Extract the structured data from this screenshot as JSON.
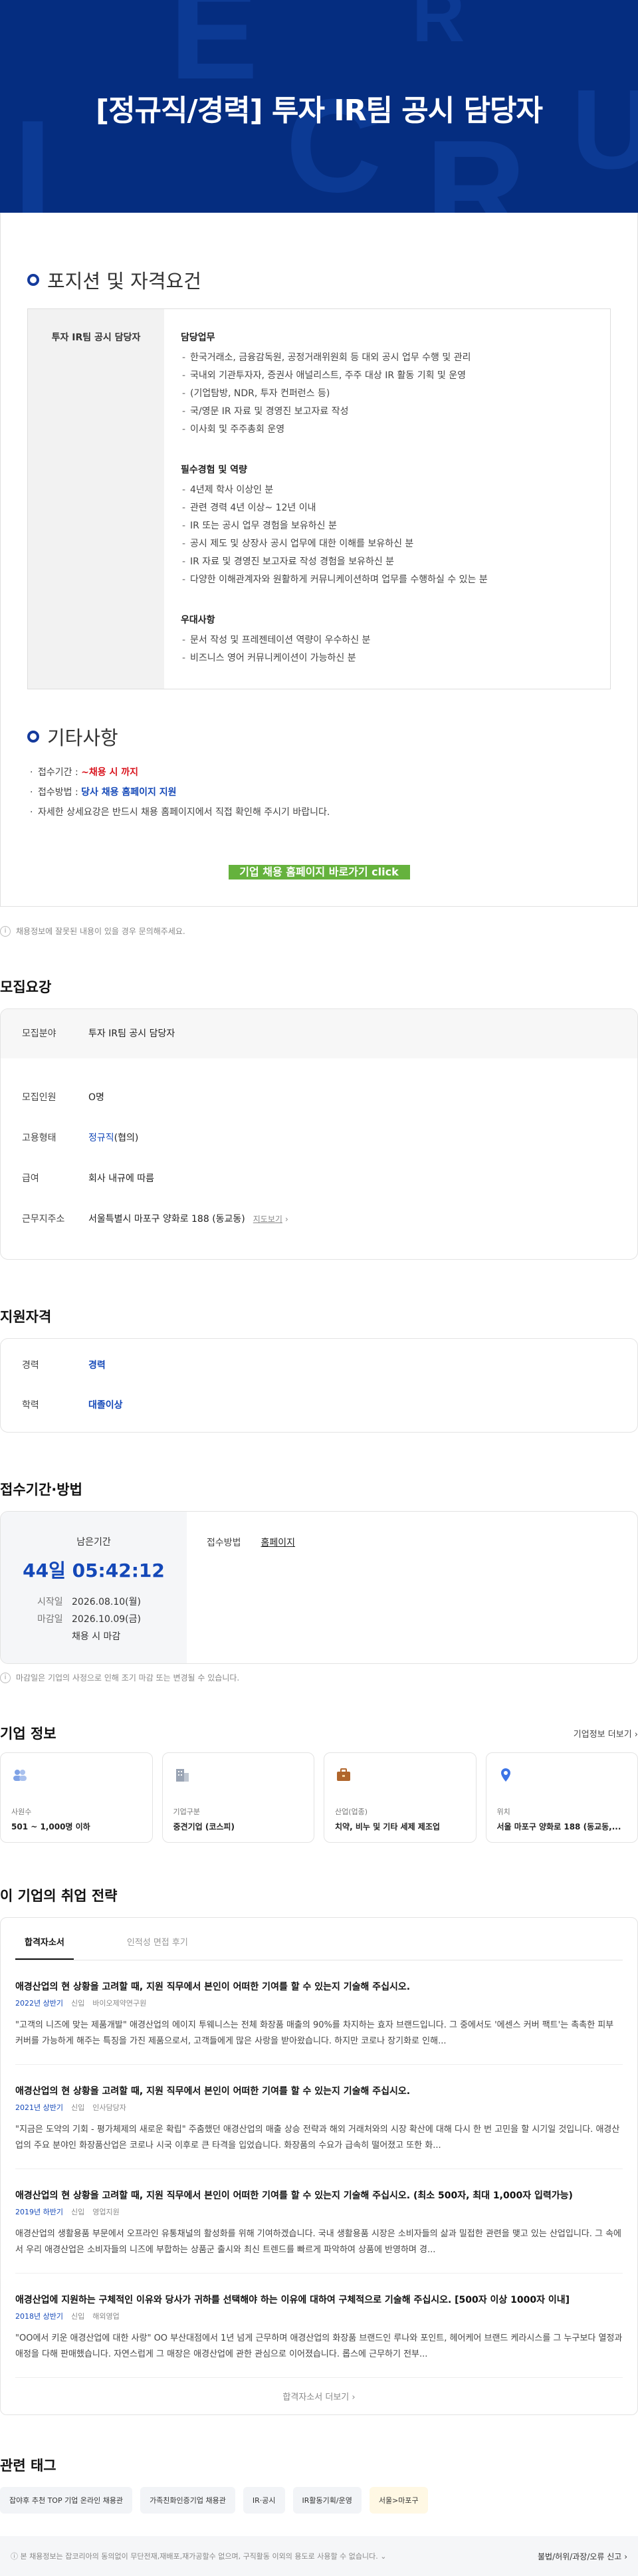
{
  "banner": {
    "title": "[정규직/경력] 투자 IR팀 공시 담당자"
  },
  "position_section": {
    "heading": "포지션 및 자격요건",
    "role_label": "투자 IR팀 공시 담당자",
    "groups": [
      {
        "title": "담당업무",
        "items": [
          "한국거래소, 금융감독원, 공정거래위원회 등 대외 공시 업무 수행 및 관리",
          "국내외 기관투자자, 증권사 애널리스트, 주주 대상 IR 활동 기획 및 운영",
          "(기업탐방, NDR, 투자 컨퍼런스 등)",
          "국/영문 IR 자료 및 경영진 보고자료 작성",
          "이사회 및 주주총회 운영"
        ]
      },
      {
        "title": "필수경험 및 역량",
        "items": [
          "4년제 학사 이상인 분",
          "관련 경력 4년 이상~ 12년 이내",
          "IR 또는 공시 업무 경험을 보유하신 분",
          "공시 제도 및 상장사 공시 업무에 대한 이해를 보유하신 분",
          "IR 자료 및 경영진 보고자료 작성 경험을 보유하신 분",
          "다양한 이해관계자와 원활하게 커뮤니케이션하며 업무를 수행하실 수 있는 분"
        ]
      },
      {
        "title": "우대사항",
        "items": [
          "문서 작성 및 프레젠테이션 역량이 우수하신 분",
          "비즈니스 영어 커뮤니케이션이 가능하신 분"
        ]
      }
    ]
  },
  "etc_section": {
    "heading": "기타사항",
    "period_label": "접수기간 : ",
    "period_value": "~채용 시 까지",
    "method_label": "접수방법 : ",
    "method_value": "당사 채용 홈페이지 지원",
    "note": "자세한 상세요강은 반드시 채용 홈페이지에서 직접 확인해 주시기 바랍니다.",
    "cta": "기업 채용 홈페이지 바로가기 click"
  },
  "report_notice": "채용정보에 잘못된 내용이 있을 경우 문의해주세요.",
  "recruit": {
    "title": "모집요강",
    "field_label": "모집분야",
    "field_value": "투자 IR팀 공시 담당자",
    "count_label": "모집인원",
    "count_value": "O명",
    "type_label": "고용형태",
    "type_value": "정규직",
    "type_suffix": "(협의)",
    "salary_label": "급여",
    "salary_value": "회사 내규에 따름",
    "location_label": "근무지주소",
    "location_value": "서울특별시 마포구 양화로 188 (동교동)",
    "map_link": "지도보기"
  },
  "qualification": {
    "title": "지원자격",
    "career_label": "경력",
    "career_value": "경력",
    "edu_label": "학력",
    "edu_value": "대졸이상"
  },
  "apply": {
    "title": "접수기간·방법",
    "remain_label": "남은기간",
    "remain_value": "44일 05:42:12",
    "start_label": "시작일",
    "start_value": "2026.08.10(월)",
    "end_label": "마감일",
    "end_value": "2026.10.09(금)",
    "end_note": "채용 시 마감",
    "method_label": "접수방법",
    "method_value": "홈페이지",
    "notice": "마감일은 기업의 사정으로 인해 조기 마감 또는 변경될 수 있습니다."
  },
  "company": {
    "title": "기업 정보",
    "more": "기업정보 더보기",
    "cards": [
      {
        "icon": "people-icon",
        "label": "사원수",
        "value": "501 ~ 1,000명 이하"
      },
      {
        "icon": "building-icon",
        "label": "기업구분",
        "value": "중견기업 (코스피)"
      },
      {
        "icon": "briefcase-icon",
        "label": "산업(업종)",
        "value": "치약, 비누 및 기타 세제 제조업"
      },
      {
        "icon": "location-pin-icon",
        "label": "위치",
        "value": "서울 마포구 양화로 188 (동교동,..."
      }
    ]
  },
  "strategy": {
    "title": "이 기업의 취업 전략",
    "tab_active": "합격자소서",
    "tab_other": "인적성 면접 후기",
    "essays": [
      {
        "q": "애경산업의 현 상황을 고려할 때, 지원 직무에서 본인이 어떠한 기여를 할 수 있는지 기술해 주십시오.",
        "year": "2022년 상반기",
        "kind": "신입",
        "dept": "바이오제약연구원",
        "text": "\"고객의 니즈에 맞는 제품개발\" 애경산업의 에이지 투웨니스는 전체 화장품 매출의 90%를 차지하는 효자 브랜드입니다. 그 중에서도 '에센스 커버 팩트'는 촉촉한 피부 커버를 가능하게 해주는 특징을 가진 제품으로서, 고객들에게 많은 사랑을 받아왔습니다. 하지만 코로나 장기화로 인해..."
      },
      {
        "q": "애경산업의 현 상황을 고려할 때, 지원 직무에서 본인이 어떠한 기여를 할 수 있는지 기술해 주십시오.",
        "year": "2021년 상반기",
        "kind": "신입",
        "dept": "인사담당자",
        "text": "\"지금은 도약의 기회 - 평가체제의 새로운 확립\" 주춤했던 애경산업의 매출 상승 전략과 해외 거래처와의 시장 확산에 대해 다시 한 번 고민을 할 시기일 것입니다. 애경산업의 주요 분야인 화장품산업은 코로나 시국 이후로 큰 타격을 입었습니다. 화장품의 수요가 급속히 떨어졌고 또한 화..."
      },
      {
        "q": "애경산업의 현 상황을 고려할 때, 지원 직무에서 본인이 어떠한 기여를 할 수 있는지 기술해 주십시오. (최소 500자, 최대 1,000자 입력가능)",
        "year": "2019년 하반기",
        "kind": "신입",
        "dept": "영업지원",
        "text": "애경산업의 생활용품 부문에서 오프라인 유통채널의 활성화를 위해 기여하겠습니다. 국내 생활용품 시장은 소비자들의 삶과 밀접한 관련을 맺고 있는 산업입니다. 그 속에서 우리 애경산업은 소비자들의 니즈에 부합하는 상품군 출시와 최신 트렌드를 빠르게 파악하여 상품에 반영하며 경..."
      },
      {
        "q": "애경산업에 지원하는 구체적인 이유와 당사가 귀하를 선택해야 하는 이유에 대하여 구체적으로 기술해 주십시오. [500자 이상 1000자 이내]",
        "year": "2018년 상반기",
        "kind": "신입",
        "dept": "해외영업",
        "text": "\"OO에서 키운 애경산업에 대한 사랑\" OO 부산대점에서 1년 넘게 근무하며 애경산업의 화장품 브랜드인 루나와 포인트, 헤어케어 브랜드 케라시스를 그 누구보다 열정과 애정을 다해 판매했습니다. 자연스럽게 그 매장은 애경산업에 관한 관심으로 이어졌습니다. 롭스에 근무하기 전부..."
      }
    ],
    "more": "합격자소서 더보기"
  },
  "tags": {
    "title": "관련 태그",
    "items": [
      "잡야후 추천 TOP 기업 온라인 채용관",
      "가족친화인증기업 채용관",
      "IR·공시",
      "IR활동기획/운영",
      "서울>마포구"
    ]
  },
  "footer": {
    "left": "본 채용정보는 잡코리아의 동의없이 무단전재,재배포,재가공할수 없으며, 구직활동 이외의 용도로 사용할 수 없습니다.",
    "right": "불법/허위/과장/오류 신고"
  },
  "colors": {
    "banner": "#052d80",
    "accent": "#1448b8",
    "red": "#d9141e",
    "cta": "#65b23d"
  }
}
